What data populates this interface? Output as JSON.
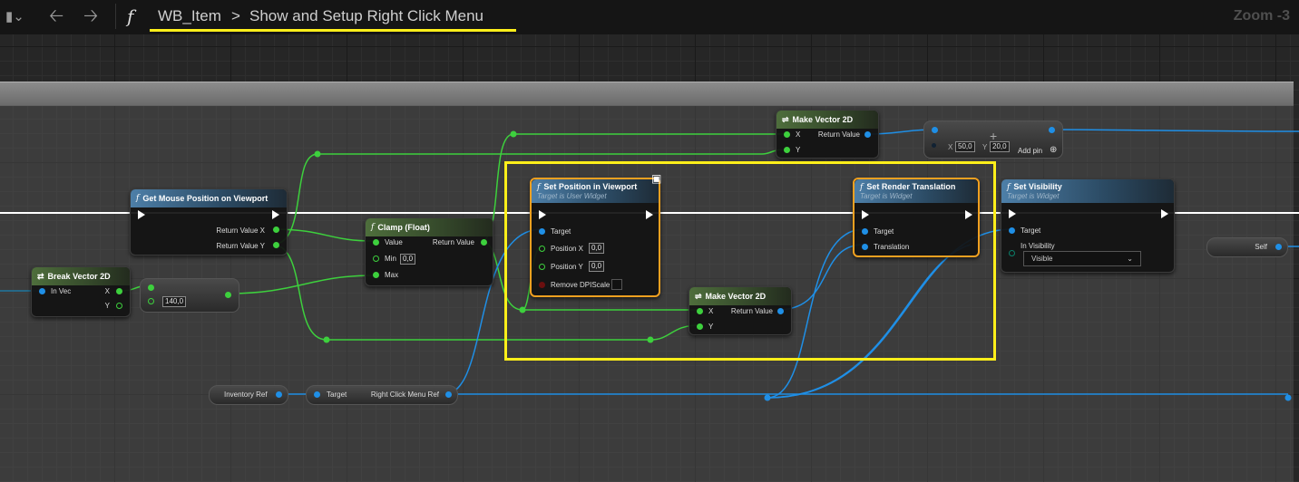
{
  "toolbar": {
    "breadcrumb_blueprint": "WB_Item",
    "breadcrumb_separator": ">",
    "breadcrumb_function": "Show and Setup Right Click Menu",
    "zoom": "Zoom -3",
    "function_symbol": "f"
  },
  "nodes": {
    "get_mouse": {
      "title": "Get Mouse Position on Viewport",
      "out_x": "Return Value X",
      "out_y": "Return Value Y"
    },
    "break_vec": {
      "title": "Break Vector 2D",
      "in": "In Vec",
      "x": "X",
      "y": "Y"
    },
    "multiply": {
      "value": "140,0"
    },
    "clamp": {
      "title": "Clamp (Float)",
      "value": "Value",
      "min": "Min",
      "min_val": "0,0",
      "max": "Max",
      "ret": "Return Value"
    },
    "make_vec_top": {
      "title": "Make Vector 2D",
      "x": "X",
      "y": "Y",
      "ret": "Return Value"
    },
    "add_node": {
      "x_label": "X",
      "x_val": "50,0",
      "y_label": "Y",
      "y_val": "20,0",
      "add_pin": "Add pin"
    },
    "set_pos": {
      "title": "Set Position in Viewport",
      "subtitle": "Target is User Widget",
      "target": "Target",
      "pos_x": "Position X",
      "pos_x_val": "0,0",
      "pos_y": "Position Y",
      "pos_y_val": "0,0",
      "remove_dpi": "Remove DPIScale"
    },
    "make_vec_mid": {
      "title": "Make Vector 2D",
      "x": "X",
      "y": "Y",
      "ret": "Return Value"
    },
    "set_render": {
      "title": "Set Render Translation",
      "subtitle": "Target is Widget",
      "target": "Target",
      "translation": "Translation"
    },
    "set_vis": {
      "title": "Set Visibility",
      "subtitle": "Target is Widget",
      "target": "Target",
      "in_vis": "In Visibility",
      "vis_val": "Visible"
    },
    "self_node": {
      "label": "Self"
    },
    "inv_ref": {
      "label": "Inventory Ref"
    },
    "rc_menu": {
      "target": "Target",
      "ret": "Right Click Menu Ref"
    }
  },
  "colors": {
    "exec": "#ffffff",
    "float": "#3dd03d",
    "object": "#1f8fe6",
    "highlight": "#ffef1a",
    "selected": "#f0a020"
  }
}
